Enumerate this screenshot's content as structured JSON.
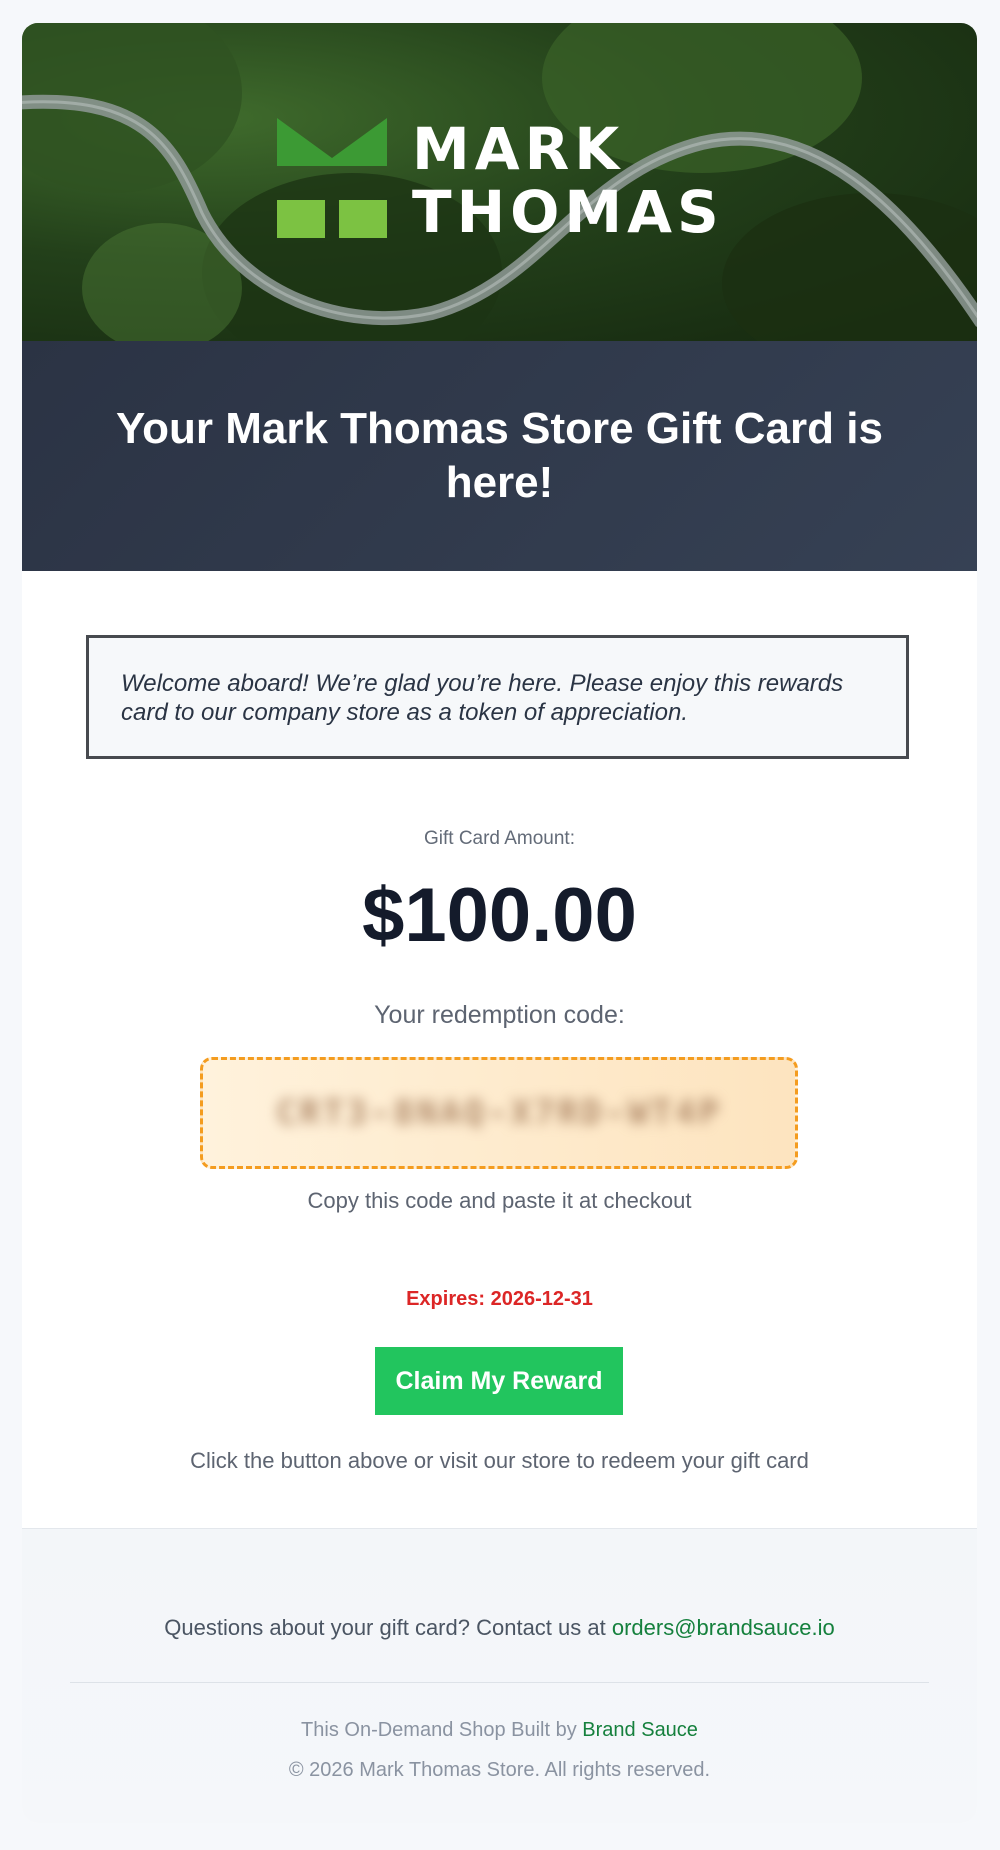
{
  "brand": {
    "logo_line1": "MARK",
    "logo_line2": "THOMAS",
    "colors": {
      "logo_dark_green": "#3c9a34",
      "logo_light_green": "#7cc242",
      "accent_green": "#22c55e",
      "link_green": "#15803d",
      "expiry_red": "#dc2626",
      "title_band": "#2b3344"
    }
  },
  "header": {
    "title": "Your Mark Thomas Store Gift Card is here!"
  },
  "welcome_message": "Welcome aboard! We’re glad you’re here. Please enjoy this rewards card to our company store as a token of appreciation.",
  "gift_card": {
    "amount_label": "Gift Card Amount:",
    "amount": "$100.00",
    "code_label": "Your redemption code:",
    "code": "CRT3-8NAQ-X7RD-WT4P",
    "copy_hint": "Copy this code and paste it at checkout",
    "expires": "Expires: 2026-12-31"
  },
  "cta": {
    "button_label": "Claim My Reward",
    "hint": "Click the button above or visit our store to redeem your gift card"
  },
  "footer": {
    "question_text": "Questions about your gift card? Contact us at ",
    "contact_email": "orders@brandsauce.io",
    "built_text": "This On-Demand Shop Built by ",
    "built_link": "Brand Sauce",
    "copyright": "© 2026 Mark Thomas Store. All rights reserved."
  }
}
